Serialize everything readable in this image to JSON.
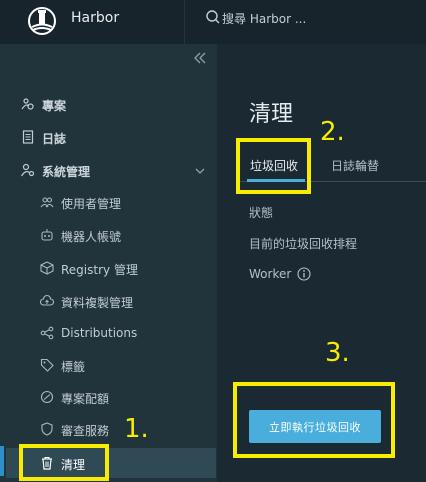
{
  "header": {
    "brand": "Harbor",
    "search_placeholder": "搜尋 Harbor ..."
  },
  "sidebar": {
    "items": [
      {
        "label": "專案",
        "icon": "project-icon"
      },
      {
        "label": "日誌",
        "icon": "log-icon"
      },
      {
        "label": "系統管理",
        "icon": "admin-icon",
        "expanded": true
      },
      {
        "label": "使用者管理",
        "icon": "users-icon"
      },
      {
        "label": "機器人帳號",
        "icon": "robot-icon"
      },
      {
        "label": "Registry 管理",
        "icon": "registry-icon"
      },
      {
        "label": "資料複製管理",
        "icon": "cloud-replication-icon"
      },
      {
        "label": "Distributions",
        "icon": "share-icon"
      },
      {
        "label": "標籤",
        "icon": "tag-icon"
      },
      {
        "label": "專案配額",
        "icon": "quota-icon"
      },
      {
        "label": "審查服務",
        "icon": "shield-icon"
      },
      {
        "label": "清理",
        "icon": "trash-icon",
        "active": true
      }
    ]
  },
  "main": {
    "title": "清理",
    "tabs": [
      {
        "label": "垃圾回收",
        "active": true
      },
      {
        "label": "日誌輪替",
        "active": false
      }
    ],
    "fields": {
      "status": "狀態",
      "schedule": "目前的垃圾回收排程",
      "worker": "Worker"
    },
    "gc_button": "立即執行垃圾回收"
  },
  "annotations": [
    "1.",
    "2.",
    "3."
  ],
  "colors": {
    "accent": "#49aedb",
    "highlight": "#f8ec00",
    "sidebar_bg": "#21333b",
    "header_bg": "#17242b"
  }
}
